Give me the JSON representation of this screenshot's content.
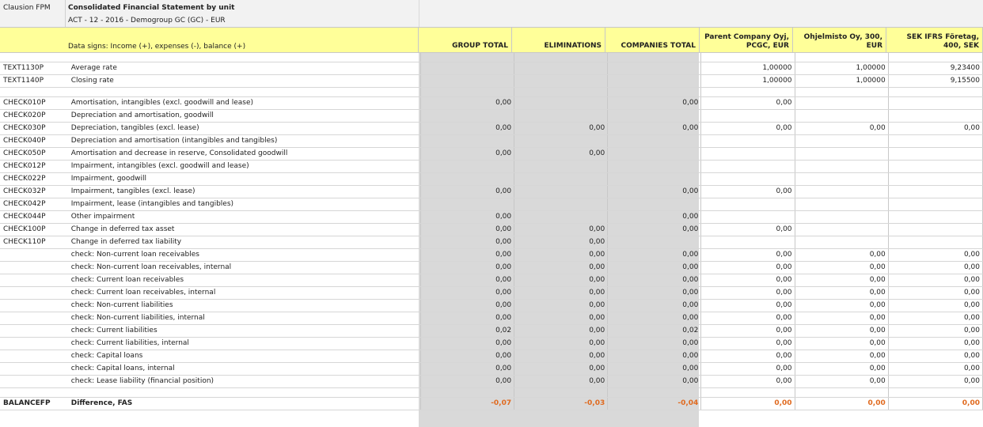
{
  "app_name": "Clausion FPM",
  "report": {
    "title": "Consolidated Financial Statement by unit",
    "subtitle": "ACT - 12 - 2016 - Demogroup GC (GC) - EUR"
  },
  "header": {
    "signs_note": "Data signs: Income (+), expenses (-), balance (+)",
    "columns": [
      "GROUP TOTAL",
      "ELIMINATIONS",
      "COMPANIES TOTAL",
      "Parent Company Oyj, PCGC, EUR",
      "Ohjelmisto Oy, 300, EUR",
      "SEK IFRS Företag, 400, SEK"
    ]
  },
  "rows": [
    {
      "blank": true
    },
    {
      "code": "TEXT1130P",
      "desc": "Average rate",
      "v": [
        "",
        "",
        "",
        "1,00000",
        "1,00000",
        "9,23400"
      ]
    },
    {
      "code": "TEXT1140P",
      "desc": "Closing rate",
      "v": [
        "",
        "",
        "",
        "1,00000",
        "1,00000",
        "9,15500"
      ]
    },
    {
      "blank": true
    },
    {
      "code": "CHECK010P",
      "desc": "Amortisation, intangibles (excl. goodwill and lease)",
      "v": [
        "0,00",
        "",
        "0,00",
        "0,00",
        "",
        ""
      ]
    },
    {
      "code": "CHECK020P",
      "desc": "Depreciation and amortisation, goodwill",
      "v": [
        "",
        "",
        "",
        "",
        "",
        ""
      ]
    },
    {
      "code": "CHECK030P",
      "desc": "Depreciation, tangibles (excl. lease)",
      "v": [
        "0,00",
        "0,00",
        "0,00",
        "0,00",
        "0,00",
        "0,00"
      ]
    },
    {
      "code": "CHECK040P",
      "desc": "Depreciation and amortisation (intangibles and tangibles)",
      "v": [
        "",
        "",
        "",
        "",
        "",
        ""
      ]
    },
    {
      "code": "CHECK050P",
      "desc": "Amortisation and decrease in reserve, Consolidated goodwill",
      "v": [
        "0,00",
        "0,00",
        "",
        "",
        "",
        ""
      ]
    },
    {
      "code": "CHECK012P",
      "desc": "Impairment, intangibles (excl. goodwill and lease)",
      "v": [
        "",
        "",
        "",
        "",
        "",
        ""
      ]
    },
    {
      "code": "CHECK022P",
      "desc": "Impairment, goodwill",
      "v": [
        "",
        "",
        "",
        "",
        "",
        ""
      ]
    },
    {
      "code": "CHECK032P",
      "desc": "Impairment, tangibles (excl. lease)",
      "v": [
        "0,00",
        "",
        "0,00",
        "0,00",
        "",
        ""
      ]
    },
    {
      "code": "CHECK042P",
      "desc": "Impairment, lease (intangibles and tangibles)",
      "v": [
        "",
        "",
        "",
        "",
        "",
        ""
      ]
    },
    {
      "code": "CHECK044P",
      "desc": "Other impairment",
      "v": [
        "0,00",
        "",
        "0,00",
        "",
        "",
        ""
      ]
    },
    {
      "code": "CHECK100P",
      "desc": "Change in deferred tax asset",
      "v": [
        "0,00",
        "0,00",
        "0,00",
        "0,00",
        "",
        ""
      ]
    },
    {
      "code": "CHECK110P",
      "desc": "Change in deferred tax liability",
      "v": [
        "0,00",
        "0,00",
        "",
        "",
        "",
        ""
      ]
    },
    {
      "code": "",
      "desc": "check: Non-current loan receivables",
      "v": [
        "0,00",
        "0,00",
        "0,00",
        "0,00",
        "0,00",
        "0,00"
      ]
    },
    {
      "code": "",
      "desc": "check: Non-current loan receivables, internal",
      "v": [
        "0,00",
        "0,00",
        "0,00",
        "0,00",
        "0,00",
        "0,00"
      ]
    },
    {
      "code": "",
      "desc": "check: Current loan receivables",
      "v": [
        "0,00",
        "0,00",
        "0,00",
        "0,00",
        "0,00",
        "0,00"
      ]
    },
    {
      "code": "",
      "desc": "check: Current loan receivables, internal",
      "v": [
        "0,00",
        "0,00",
        "0,00",
        "0,00",
        "0,00",
        "0,00"
      ]
    },
    {
      "code": "",
      "desc": "check: Non-current liabilities",
      "v": [
        "0,00",
        "0,00",
        "0,00",
        "0,00",
        "0,00",
        "0,00"
      ]
    },
    {
      "code": "",
      "desc": "check: Non-current liabilities, internal",
      "v": [
        "0,00",
        "0,00",
        "0,00",
        "0,00",
        "0,00",
        "0,00"
      ]
    },
    {
      "code": "",
      "desc": "check: Current liabilities",
      "v": [
        "0,02",
        "0,00",
        "0,02",
        "0,00",
        "0,00",
        "0,00"
      ]
    },
    {
      "code": "",
      "desc": "check: Current liabilities, internal",
      "v": [
        "0,00",
        "0,00",
        "0,00",
        "0,00",
        "0,00",
        "0,00"
      ]
    },
    {
      "code": "",
      "desc": "check: Capital loans",
      "v": [
        "0,00",
        "0,00",
        "0,00",
        "0,00",
        "0,00",
        "0,00"
      ]
    },
    {
      "code": "",
      "desc": "check: Capital loans, internal",
      "v": [
        "0,00",
        "0,00",
        "0,00",
        "0,00",
        "0,00",
        "0,00"
      ]
    },
    {
      "code": "",
      "desc": "check: Lease liability (financial position)",
      "v": [
        "0,00",
        "0,00",
        "0,00",
        "0,00",
        "0,00",
        "0,00"
      ]
    },
    {
      "blank": true
    },
    {
      "code": "BALANCEFP",
      "desc": "Difference, FAS",
      "bold": true,
      "highlight": true,
      "v": [
        "-0,07",
        "-0,03",
        "-0,04",
        "0,00",
        "0,00",
        "0,00"
      ]
    }
  ],
  "colors": {
    "header_bg": "#ffff99",
    "total_col_bg": "#d9d9d9",
    "difference_text": "#e06a1f"
  }
}
